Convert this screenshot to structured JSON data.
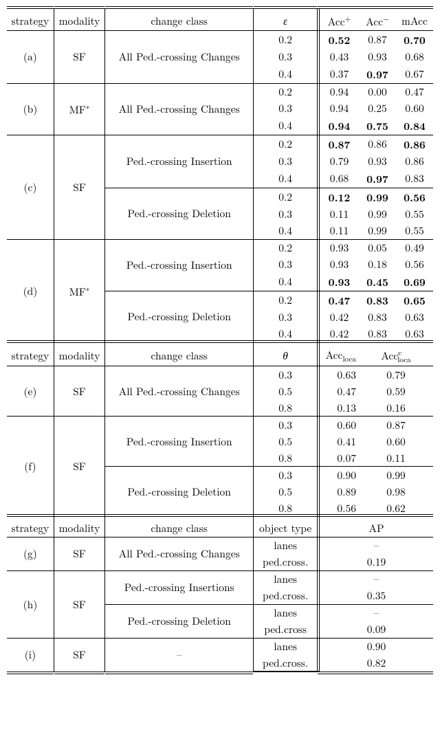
{
  "headers_top": {
    "strategy": "strategy",
    "modality": "modality",
    "change": "change class",
    "eps": "ε",
    "accp": "Acc",
    "accp_sup": "+",
    "accm": "Acc",
    "accm_sup": "−",
    "macc": "mAcc"
  },
  "headers_mid": {
    "strategy": "strategy",
    "modality": "modality",
    "change": "change class",
    "theta": "θ",
    "accloca": "Acc",
    "accloca_sub": "loca",
    "accloca_c": "Acc",
    "accloca_c_sup": "c",
    "accloca_c_sub": "loca"
  },
  "headers_bot": {
    "strategy": "strategy",
    "modality": "modality",
    "change": "change class",
    "obj": "object type",
    "ap": "AP"
  },
  "labels": {
    "a": "(a)",
    "b": "(b)",
    "c": "(c)",
    "d": "(d)",
    "e": "(e)",
    "f": "(f)",
    "g": "(g)",
    "h": "(h)",
    "i": "(i)",
    "SF": "SF",
    "MF": "MF",
    "all": "All Ped.-crossing Changes",
    "ins": "Ped.-crossing Insertion",
    "inss": "Ped.-crossing Insertions",
    "del": "Ped.-crossing Deletion",
    "lanes": "lanes",
    "pedcross": "ped.cross.",
    "pedcross2": "ped.cross",
    "dash": "–"
  },
  "chart_data": {
    "type": "table",
    "sections": [
      {
        "name": "accuracy",
        "param": "epsilon",
        "metrics": [
          "Acc+",
          "Acc-",
          "mAcc"
        ],
        "groups": [
          {
            "id": "a",
            "strategy": "(a)",
            "modality": "SF",
            "change": "All Ped.-crossing Changes",
            "rows": [
              {
                "p": 0.2,
                "v": [
                  0.52,
                  0.87,
                  0.7
                ],
                "bold": [
                  true,
                  false,
                  true
                ]
              },
              {
                "p": 0.3,
                "v": [
                  0.43,
                  0.93,
                  0.68
                ],
                "bold": [
                  false,
                  false,
                  false
                ]
              },
              {
                "p": 0.4,
                "v": [
                  0.37,
                  0.97,
                  0.67
                ],
                "bold": [
                  false,
                  true,
                  false
                ]
              }
            ]
          },
          {
            "id": "b",
            "strategy": "(b)",
            "modality": "MF*",
            "change": "All Ped.-crossing Changes",
            "rows": [
              {
                "p": 0.2,
                "v": [
                  0.94,
                  0.0,
                  0.47
                ],
                "bold": [
                  false,
                  false,
                  false
                ]
              },
              {
                "p": 0.3,
                "v": [
                  0.94,
                  0.25,
                  0.6
                ],
                "bold": [
                  false,
                  false,
                  false
                ]
              },
              {
                "p": 0.4,
                "v": [
                  0.94,
                  0.75,
                  0.84
                ],
                "bold": [
                  true,
                  true,
                  true
                ]
              }
            ]
          },
          {
            "id": "c",
            "strategy": "(c)",
            "modality": "SF",
            "change": "Ped.-crossing Insertion / Deletion",
            "subgroups": [
              {
                "change": "Ped.-crossing Insertion",
                "rows": [
                  {
                    "p": 0.2,
                    "v": [
                      0.87,
                      0.86,
                      0.86
                    ],
                    "bold": [
                      true,
                      false,
                      true
                    ]
                  },
                  {
                    "p": 0.3,
                    "v": [
                      0.79,
                      0.93,
                      0.86
                    ],
                    "bold": [
                      false,
                      false,
                      false
                    ]
                  },
                  {
                    "p": 0.4,
                    "v": [
                      0.68,
                      0.97,
                      0.83
                    ],
                    "bold": [
                      false,
                      true,
                      false
                    ]
                  }
                ]
              },
              {
                "change": "Ped.-crossing Deletion",
                "rows": [
                  {
                    "p": 0.2,
                    "v": [
                      0.12,
                      0.99,
                      0.56
                    ],
                    "bold": [
                      true,
                      true,
                      true
                    ]
                  },
                  {
                    "p": 0.3,
                    "v": [
                      0.11,
                      0.99,
                      0.55
                    ],
                    "bold": [
                      false,
                      false,
                      false
                    ]
                  },
                  {
                    "p": 0.4,
                    "v": [
                      0.11,
                      0.99,
                      0.55
                    ],
                    "bold": [
                      false,
                      false,
                      false
                    ]
                  }
                ]
              }
            ]
          },
          {
            "id": "d",
            "strategy": "(d)",
            "modality": "MF*",
            "change": "Ped.-crossing Insertion / Deletion",
            "subgroups": [
              {
                "change": "Ped.-crossing Insertion",
                "rows": [
                  {
                    "p": 0.2,
                    "v": [
                      0.93,
                      0.05,
                      0.49
                    ],
                    "bold": [
                      false,
                      false,
                      false
                    ]
                  },
                  {
                    "p": 0.3,
                    "v": [
                      0.93,
                      0.18,
                      0.56
                    ],
                    "bold": [
                      false,
                      false,
                      false
                    ]
                  },
                  {
                    "p": 0.4,
                    "v": [
                      0.93,
                      0.45,
                      0.69
                    ],
                    "bold": [
                      true,
                      true,
                      true
                    ]
                  }
                ]
              },
              {
                "change": "Ped.-crossing Deletion",
                "rows": [
                  {
                    "p": 0.2,
                    "v": [
                      0.47,
                      0.83,
                      0.65
                    ],
                    "bold": [
                      true,
                      true,
                      true
                    ]
                  },
                  {
                    "p": 0.3,
                    "v": [
                      0.42,
                      0.83,
                      0.63
                    ],
                    "bold": [
                      false,
                      false,
                      false
                    ]
                  },
                  {
                    "p": 0.4,
                    "v": [
                      0.42,
                      0.83,
                      0.63
                    ],
                    "bold": [
                      false,
                      false,
                      false
                    ]
                  }
                ]
              }
            ]
          }
        ]
      },
      {
        "name": "localization",
        "param": "theta",
        "metrics": [
          "Acc_loca",
          "Acc_loca^c"
        ],
        "groups": [
          {
            "id": "e",
            "strategy": "(e)",
            "modality": "SF",
            "change": "All Ped.-crossing Changes",
            "rows": [
              {
                "p": 0.3,
                "v": [
                  0.63,
                  0.79
                ]
              },
              {
                "p": 0.5,
                "v": [
                  0.47,
                  0.59
                ]
              },
              {
                "p": 0.8,
                "v": [
                  0.13,
                  0.16
                ]
              }
            ]
          },
          {
            "id": "f",
            "strategy": "(f)",
            "modality": "SF",
            "change": "Ped.-crossing Insertion / Deletion",
            "subgroups": [
              {
                "change": "Ped.-crossing Insertion",
                "rows": [
                  {
                    "p": 0.3,
                    "v": [
                      0.6,
                      0.87
                    ]
                  },
                  {
                    "p": 0.5,
                    "v": [
                      0.41,
                      0.6
                    ]
                  },
                  {
                    "p": 0.8,
                    "v": [
                      0.07,
                      0.11
                    ]
                  }
                ]
              },
              {
                "change": "Ped.-crossing Deletion",
                "rows": [
                  {
                    "p": 0.3,
                    "v": [
                      0.9,
                      0.99
                    ]
                  },
                  {
                    "p": 0.5,
                    "v": [
                      0.89,
                      0.98
                    ]
                  },
                  {
                    "p": 0.8,
                    "v": [
                      0.56,
                      0.62
                    ]
                  }
                ]
              }
            ]
          }
        ]
      },
      {
        "name": "ap",
        "metrics": [
          "AP"
        ],
        "groups": [
          {
            "id": "g",
            "strategy": "(g)",
            "modality": "SF",
            "change": "All Ped.-crossing Changes",
            "rows": [
              {
                "obj": "lanes",
                "v": "–"
              },
              {
                "obj": "ped.cross.",
                "v": 0.19
              }
            ]
          },
          {
            "id": "h",
            "strategy": "(h)",
            "modality": "SF",
            "subgroups": [
              {
                "change": "Ped.-crossing Insertions",
                "rows": [
                  {
                    "obj": "lanes",
                    "v": "–"
                  },
                  {
                    "obj": "ped.cross.",
                    "v": 0.35
                  }
                ]
              },
              {
                "change": "Ped.-crossing Deletion",
                "rows": [
                  {
                    "obj": "lanes",
                    "v": "–"
                  },
                  {
                    "obj": "ped.cross",
                    "v": 0.09
                  }
                ]
              }
            ]
          },
          {
            "id": "i",
            "strategy": "(i)",
            "modality": "SF",
            "change": "–",
            "rows": [
              {
                "obj": "lanes",
                "v": 0.9
              },
              {
                "obj": "ped.cross.",
                "v": 0.82
              }
            ]
          }
        ]
      }
    ]
  },
  "a": {
    "e": [
      "0.2",
      "0.3",
      "0.4"
    ],
    "p": [
      "0.52",
      "0.87",
      "0.70"
    ],
    "m": [
      "0.43",
      "0.93",
      "0.68"
    ],
    "l": [
      "0.37",
      "0.97",
      "0.67"
    ]
  },
  "b": {
    "e": [
      "0.2",
      "0.3",
      "0.4"
    ],
    "p": [
      "0.94",
      "0.00",
      "0.47"
    ],
    "m": [
      "0.94",
      "0.25",
      "0.60"
    ],
    "l": [
      "0.94",
      "0.75",
      "0.84"
    ]
  },
  "c1": {
    "e": [
      "0.2",
      "0.3",
      "0.4"
    ],
    "p": [
      "0.87",
      "0.86",
      "0.86"
    ],
    "m": [
      "0.79",
      "0.93",
      "0.86"
    ],
    "l": [
      "0.68",
      "0.97",
      "0.83"
    ]
  },
  "c2": {
    "e": [
      "0.2",
      "0.3",
      "0.4"
    ],
    "p": [
      "0.12",
      "0.99",
      "0.56"
    ],
    "m": [
      "0.11",
      "0.99",
      "0.55"
    ],
    "l": [
      "0.11",
      "0.99",
      "0.55"
    ]
  },
  "d1": {
    "e": [
      "0.2",
      "0.3",
      "0.4"
    ],
    "p": [
      "0.93",
      "0.05",
      "0.49"
    ],
    "m": [
      "0.93",
      "0.18",
      "0.56"
    ],
    "l": [
      "0.93",
      "0.45",
      "0.69"
    ]
  },
  "d2": {
    "e": [
      "0.2",
      "0.3",
      "0.4"
    ],
    "p": [
      "0.47",
      "0.83",
      "0.65"
    ],
    "m": [
      "0.42",
      "0.83",
      "0.63"
    ],
    "l": [
      "0.42",
      "0.83",
      "0.63"
    ]
  },
  "e_": {
    "t": [
      "0.3",
      "0.5",
      "0.8"
    ],
    "a": [
      "0.63",
      "0.79"
    ],
    "b": [
      "0.47",
      "0.59"
    ],
    "c": [
      "0.13",
      "0.16"
    ]
  },
  "f1": {
    "t": [
      "0.3",
      "0.5",
      "0.8"
    ],
    "a": [
      "0.60",
      "0.87"
    ],
    "b": [
      "0.41",
      "0.60"
    ],
    "c": [
      "0.07",
      "0.11"
    ]
  },
  "f2": {
    "t": [
      "0.3",
      "0.5",
      "0.8"
    ],
    "a": [
      "0.90",
      "0.99"
    ],
    "b": [
      "0.89",
      "0.98"
    ],
    "c": [
      "0.56",
      "0.62"
    ]
  },
  "g": {
    "v": [
      "–",
      "0.19"
    ]
  },
  "h1": {
    "v": [
      "–",
      "0.35"
    ]
  },
  "h2": {
    "v": [
      "–",
      "0.09"
    ]
  },
  "i": {
    "v": [
      "0.90",
      "0.82"
    ]
  }
}
